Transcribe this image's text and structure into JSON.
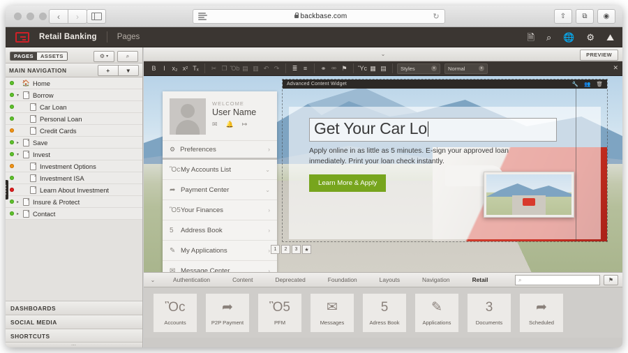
{
  "browser": {
    "address": "backbase.com",
    "lock_icon": "lock-icon",
    "reader_icon": "reader-view-icon",
    "reload_icon": "reload-icon",
    "back_icon": "‹",
    "forward_icon": "›",
    "sidebar_icon": "sidebar-toggle-icon",
    "share_icon": "⇧",
    "tabs_icon": "⧉",
    "downloads_icon": "⬇"
  },
  "app_header": {
    "logo": "backbase-logo",
    "title": "Retail Banking",
    "section": "Pages",
    "icons": [
      {
        "name": "page-icon",
        "glyph": "὜b"
      },
      {
        "name": "search-comment-icon",
        "glyph": "⌕"
      },
      {
        "name": "globe-icon",
        "glyph": "⊕"
      },
      {
        "name": "gear-icon",
        "glyph": "⚙"
      },
      {
        "name": "image-icon",
        "glyph": "⛰"
      }
    ]
  },
  "left_panel": {
    "tabs": [
      {
        "label": "PAGES",
        "active": true
      },
      {
        "label": "ASSETS",
        "active": false
      }
    ],
    "gear_button": "⚙",
    "gear_caret": "▾",
    "search_button": "⌕",
    "collapse_left": "«",
    "collapse_right": "»",
    "nav_header": "MAIN NAVIGATION",
    "add_button": "+",
    "add_caret": "▾",
    "tree": [
      {
        "label": "Home",
        "status": "green",
        "indent": 0,
        "twist": "",
        "icon": "home-icon"
      },
      {
        "label": "Borrow",
        "status": "green",
        "indent": 0,
        "twist": "▾",
        "icon": "page-icon"
      },
      {
        "label": "Car Loan",
        "status": "green",
        "indent": 1,
        "twist": "",
        "icon": "page-icon"
      },
      {
        "label": "Personal Loan",
        "status": "green",
        "indent": 1,
        "twist": "",
        "icon": "page-icon"
      },
      {
        "label": "Credit Cards",
        "status": "orange",
        "indent": 1,
        "twist": "",
        "icon": "page-icon"
      },
      {
        "label": "Save",
        "status": "green",
        "indent": 0,
        "twist": "▸",
        "icon": "page-icon"
      },
      {
        "label": "Invest",
        "status": "green",
        "indent": 0,
        "twist": "▾",
        "icon": "page-icon"
      },
      {
        "label": "Investment Options",
        "status": "orange",
        "indent": 1,
        "twist": "",
        "icon": "page-icon"
      },
      {
        "label": "Investment ISA",
        "status": "green",
        "indent": 1,
        "twist": "",
        "icon": "page-icon"
      },
      {
        "label": "Learn About Investment",
        "status": "red",
        "indent": 1,
        "twist": "",
        "icon": "page-icon"
      },
      {
        "label": "Insure & Protect",
        "status": "green",
        "indent": 0,
        "twist": "▸",
        "icon": "page-icon"
      },
      {
        "label": "Contact",
        "status": "green",
        "indent": 0,
        "twist": "▸",
        "icon": "page-icon"
      }
    ],
    "sections": [
      "DASHBOARDS",
      "SOCIAL MEDIA",
      "SHORTCUTS"
    ],
    "grip": "⋯"
  },
  "editor": {
    "preview_button": "PREVIEW",
    "collapse_chevron": "»",
    "close_icon": "✕",
    "toolbar_groups": [
      {
        "items": [
          {
            "name": "bold-icon",
            "glyph": "B",
            "dim": false
          },
          {
            "name": "italic-icon",
            "glyph": "I",
            "dim": false
          },
          {
            "name": "subscript-icon",
            "glyph": "x₂",
            "dim": false
          },
          {
            "name": "superscript-icon",
            "glyph": "x²",
            "dim": false
          },
          {
            "name": "remove-format-icon",
            "glyph": "Tₓ",
            "dim": false
          }
        ]
      },
      {
        "items": [
          {
            "name": "cut-icon",
            "glyph": "✂",
            "dim": true
          },
          {
            "name": "copy-icon",
            "glyph": "❐",
            "dim": true
          },
          {
            "name": "paste-icon",
            "glyph": "Ὄb",
            "dim": true
          },
          {
            "name": "paste-text-icon",
            "glyph": "▤",
            "dim": true
          },
          {
            "name": "paste-word-icon",
            "glyph": "▥",
            "dim": true
          },
          {
            "name": "undo-icon",
            "glyph": "↶",
            "dim": true
          },
          {
            "name": "redo-icon",
            "glyph": "↷",
            "dim": true
          }
        ]
      },
      {
        "items": [
          {
            "name": "numbered-list-icon",
            "glyph": "≣",
            "dim": false
          },
          {
            "name": "bulleted-list-icon",
            "glyph": "≡",
            "dim": false
          }
        ]
      },
      {
        "items": [
          {
            "name": "link-icon",
            "glyph": "⚭",
            "dim": false
          },
          {
            "name": "unlink-icon",
            "glyph": "⚮",
            "dim": true
          },
          {
            "name": "anchor-icon",
            "glyph": "⚑",
            "dim": false
          }
        ]
      },
      {
        "items": [
          {
            "name": "image-icon",
            "glyph": "Ὓc",
            "dim": false
          },
          {
            "name": "table-icon",
            "glyph": "▦",
            "dim": false
          },
          {
            "name": "page-break-icon",
            "glyph": "▤",
            "dim": false
          }
        ]
      }
    ],
    "selects": [
      {
        "name": "styles-select",
        "value": "Styles"
      },
      {
        "name": "format-select",
        "value": "Normal"
      }
    ]
  },
  "preview_panel": {
    "welcome_label": "WELCOME",
    "user_name": "User Name",
    "user_icons": [
      {
        "name": "mail-icon",
        "glyph": "✉"
      },
      {
        "name": "bell-icon",
        "glyph": "ὑ4"
      },
      {
        "name": "logout-icon",
        "glyph": "↦"
      }
    ],
    "preferences": {
      "label": "Preferences",
      "icon": "⚙",
      "chevron": "›"
    },
    "menu": [
      {
        "label": "My Accounts List",
        "icon": "Ὃc",
        "icon_name": "briefcase-icon",
        "chevron": "⌄"
      },
      {
        "label": "Payment Center",
        "icon": "➦",
        "icon_name": "arrow-forward-icon",
        "chevron": "⌄"
      },
      {
        "label": "Your Finances",
        "icon": "Ὃ5",
        "icon_name": "banknote-icon",
        "chevron": "›"
      },
      {
        "label": "Address Book",
        "icon": "὆5",
        "icon_name": "people-icon",
        "chevron": "›"
      },
      {
        "label": "My Applications",
        "icon": "✎",
        "icon_name": "pencil-icon",
        "chevron": "›"
      },
      {
        "label": "Message Center",
        "icon": "✉",
        "icon_name": "envelope-icon",
        "chevron": "›"
      }
    ]
  },
  "hero_widget": {
    "widget_title": "Advanced Content Widget",
    "widget_actions": [
      {
        "name": "wrench-icon",
        "glyph": "ὒ7"
      },
      {
        "name": "users-icon",
        "glyph": "὆5"
      },
      {
        "name": "trash-icon",
        "glyph": "Ὕ1"
      }
    ],
    "headline": "Get Your Car Lo",
    "body": "Apply online in as little as 5 minutes. E-sign your approved loan inmediately. Print your loan check instantly.",
    "cta_label": "Learn More & Apply",
    "cta_color": "#77a51d",
    "pager": [
      "1",
      "2",
      "3",
      "★"
    ]
  },
  "widget_bar": {
    "dropdown_icon": "⌄",
    "tabs": [
      {
        "label": "Authentication",
        "active": false
      },
      {
        "label": "Content",
        "active": false
      },
      {
        "label": "Deprecated",
        "active": false
      },
      {
        "label": "Foundation",
        "active": false
      },
      {
        "label": "Layouts",
        "active": false
      },
      {
        "label": "Navigation",
        "active": false
      },
      {
        "label": "Retail",
        "active": true
      }
    ],
    "search_placeholder": "",
    "search_icon": "⌕",
    "tag_icon": "⚑"
  },
  "palette": [
    {
      "label": "Accounts",
      "icon": "Ὃc",
      "icon_name": "briefcase-icon"
    },
    {
      "label": "P2P Payment",
      "icon": "➦",
      "icon_name": "arrow-forward-icon"
    },
    {
      "label": "PFM",
      "icon": "Ὃ5",
      "icon_name": "banknote-icon"
    },
    {
      "label": "Messages",
      "icon": "✉",
      "icon_name": "envelope-icon"
    },
    {
      "label": "Adress Book",
      "icon": "὆5",
      "icon_name": "people-icon"
    },
    {
      "label": "Applications",
      "icon": "✎",
      "icon_name": "pencil-icon"
    },
    {
      "label": "Documents",
      "icon": "὜3",
      "icon_name": "archive-box-icon"
    },
    {
      "label": "Scheduled",
      "icon": "➦",
      "icon_name": "arrow-forward-icon"
    }
  ]
}
